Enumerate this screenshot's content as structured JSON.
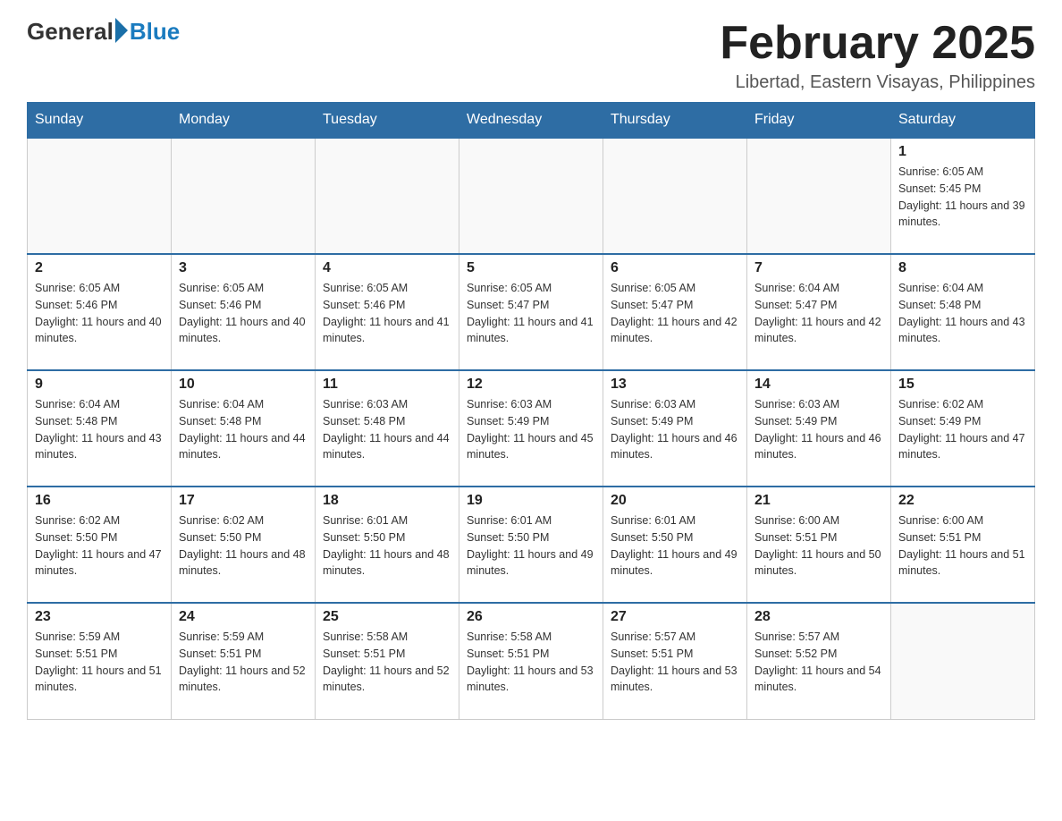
{
  "header": {
    "logo_general": "General",
    "logo_blue": "Blue",
    "month_title": "February 2025",
    "location": "Libertad, Eastern Visayas, Philippines"
  },
  "days_of_week": [
    "Sunday",
    "Monday",
    "Tuesday",
    "Wednesday",
    "Thursday",
    "Friday",
    "Saturday"
  ],
  "weeks": [
    [
      {
        "day": "",
        "empty": true
      },
      {
        "day": "",
        "empty": true
      },
      {
        "day": "",
        "empty": true
      },
      {
        "day": "",
        "empty": true
      },
      {
        "day": "",
        "empty": true
      },
      {
        "day": "",
        "empty": true
      },
      {
        "day": "1",
        "sunrise": "Sunrise: 6:05 AM",
        "sunset": "Sunset: 5:45 PM",
        "daylight": "Daylight: 11 hours and 39 minutes."
      }
    ],
    [
      {
        "day": "2",
        "sunrise": "Sunrise: 6:05 AM",
        "sunset": "Sunset: 5:46 PM",
        "daylight": "Daylight: 11 hours and 40 minutes."
      },
      {
        "day": "3",
        "sunrise": "Sunrise: 6:05 AM",
        "sunset": "Sunset: 5:46 PM",
        "daylight": "Daylight: 11 hours and 40 minutes."
      },
      {
        "day": "4",
        "sunrise": "Sunrise: 6:05 AM",
        "sunset": "Sunset: 5:46 PM",
        "daylight": "Daylight: 11 hours and 41 minutes."
      },
      {
        "day": "5",
        "sunrise": "Sunrise: 6:05 AM",
        "sunset": "Sunset: 5:47 PM",
        "daylight": "Daylight: 11 hours and 41 minutes."
      },
      {
        "day": "6",
        "sunrise": "Sunrise: 6:05 AM",
        "sunset": "Sunset: 5:47 PM",
        "daylight": "Daylight: 11 hours and 42 minutes."
      },
      {
        "day": "7",
        "sunrise": "Sunrise: 6:04 AM",
        "sunset": "Sunset: 5:47 PM",
        "daylight": "Daylight: 11 hours and 42 minutes."
      },
      {
        "day": "8",
        "sunrise": "Sunrise: 6:04 AM",
        "sunset": "Sunset: 5:48 PM",
        "daylight": "Daylight: 11 hours and 43 minutes."
      }
    ],
    [
      {
        "day": "9",
        "sunrise": "Sunrise: 6:04 AM",
        "sunset": "Sunset: 5:48 PM",
        "daylight": "Daylight: 11 hours and 43 minutes."
      },
      {
        "day": "10",
        "sunrise": "Sunrise: 6:04 AM",
        "sunset": "Sunset: 5:48 PM",
        "daylight": "Daylight: 11 hours and 44 minutes."
      },
      {
        "day": "11",
        "sunrise": "Sunrise: 6:03 AM",
        "sunset": "Sunset: 5:48 PM",
        "daylight": "Daylight: 11 hours and 44 minutes."
      },
      {
        "day": "12",
        "sunrise": "Sunrise: 6:03 AM",
        "sunset": "Sunset: 5:49 PM",
        "daylight": "Daylight: 11 hours and 45 minutes."
      },
      {
        "day": "13",
        "sunrise": "Sunrise: 6:03 AM",
        "sunset": "Sunset: 5:49 PM",
        "daylight": "Daylight: 11 hours and 46 minutes."
      },
      {
        "day": "14",
        "sunrise": "Sunrise: 6:03 AM",
        "sunset": "Sunset: 5:49 PM",
        "daylight": "Daylight: 11 hours and 46 minutes."
      },
      {
        "day": "15",
        "sunrise": "Sunrise: 6:02 AM",
        "sunset": "Sunset: 5:49 PM",
        "daylight": "Daylight: 11 hours and 47 minutes."
      }
    ],
    [
      {
        "day": "16",
        "sunrise": "Sunrise: 6:02 AM",
        "sunset": "Sunset: 5:50 PM",
        "daylight": "Daylight: 11 hours and 47 minutes."
      },
      {
        "day": "17",
        "sunrise": "Sunrise: 6:02 AM",
        "sunset": "Sunset: 5:50 PM",
        "daylight": "Daylight: 11 hours and 48 minutes."
      },
      {
        "day": "18",
        "sunrise": "Sunrise: 6:01 AM",
        "sunset": "Sunset: 5:50 PM",
        "daylight": "Daylight: 11 hours and 48 minutes."
      },
      {
        "day": "19",
        "sunrise": "Sunrise: 6:01 AM",
        "sunset": "Sunset: 5:50 PM",
        "daylight": "Daylight: 11 hours and 49 minutes."
      },
      {
        "day": "20",
        "sunrise": "Sunrise: 6:01 AM",
        "sunset": "Sunset: 5:50 PM",
        "daylight": "Daylight: 11 hours and 49 minutes."
      },
      {
        "day": "21",
        "sunrise": "Sunrise: 6:00 AM",
        "sunset": "Sunset: 5:51 PM",
        "daylight": "Daylight: 11 hours and 50 minutes."
      },
      {
        "day": "22",
        "sunrise": "Sunrise: 6:00 AM",
        "sunset": "Sunset: 5:51 PM",
        "daylight": "Daylight: 11 hours and 51 minutes."
      }
    ],
    [
      {
        "day": "23",
        "sunrise": "Sunrise: 5:59 AM",
        "sunset": "Sunset: 5:51 PM",
        "daylight": "Daylight: 11 hours and 51 minutes."
      },
      {
        "day": "24",
        "sunrise": "Sunrise: 5:59 AM",
        "sunset": "Sunset: 5:51 PM",
        "daylight": "Daylight: 11 hours and 52 minutes."
      },
      {
        "day": "25",
        "sunrise": "Sunrise: 5:58 AM",
        "sunset": "Sunset: 5:51 PM",
        "daylight": "Daylight: 11 hours and 52 minutes."
      },
      {
        "day": "26",
        "sunrise": "Sunrise: 5:58 AM",
        "sunset": "Sunset: 5:51 PM",
        "daylight": "Daylight: 11 hours and 53 minutes."
      },
      {
        "day": "27",
        "sunrise": "Sunrise: 5:57 AM",
        "sunset": "Sunset: 5:51 PM",
        "daylight": "Daylight: 11 hours and 53 minutes."
      },
      {
        "day": "28",
        "sunrise": "Sunrise: 5:57 AM",
        "sunset": "Sunset: 5:52 PM",
        "daylight": "Daylight: 11 hours and 54 minutes."
      },
      {
        "day": "",
        "empty": true
      }
    ]
  ]
}
